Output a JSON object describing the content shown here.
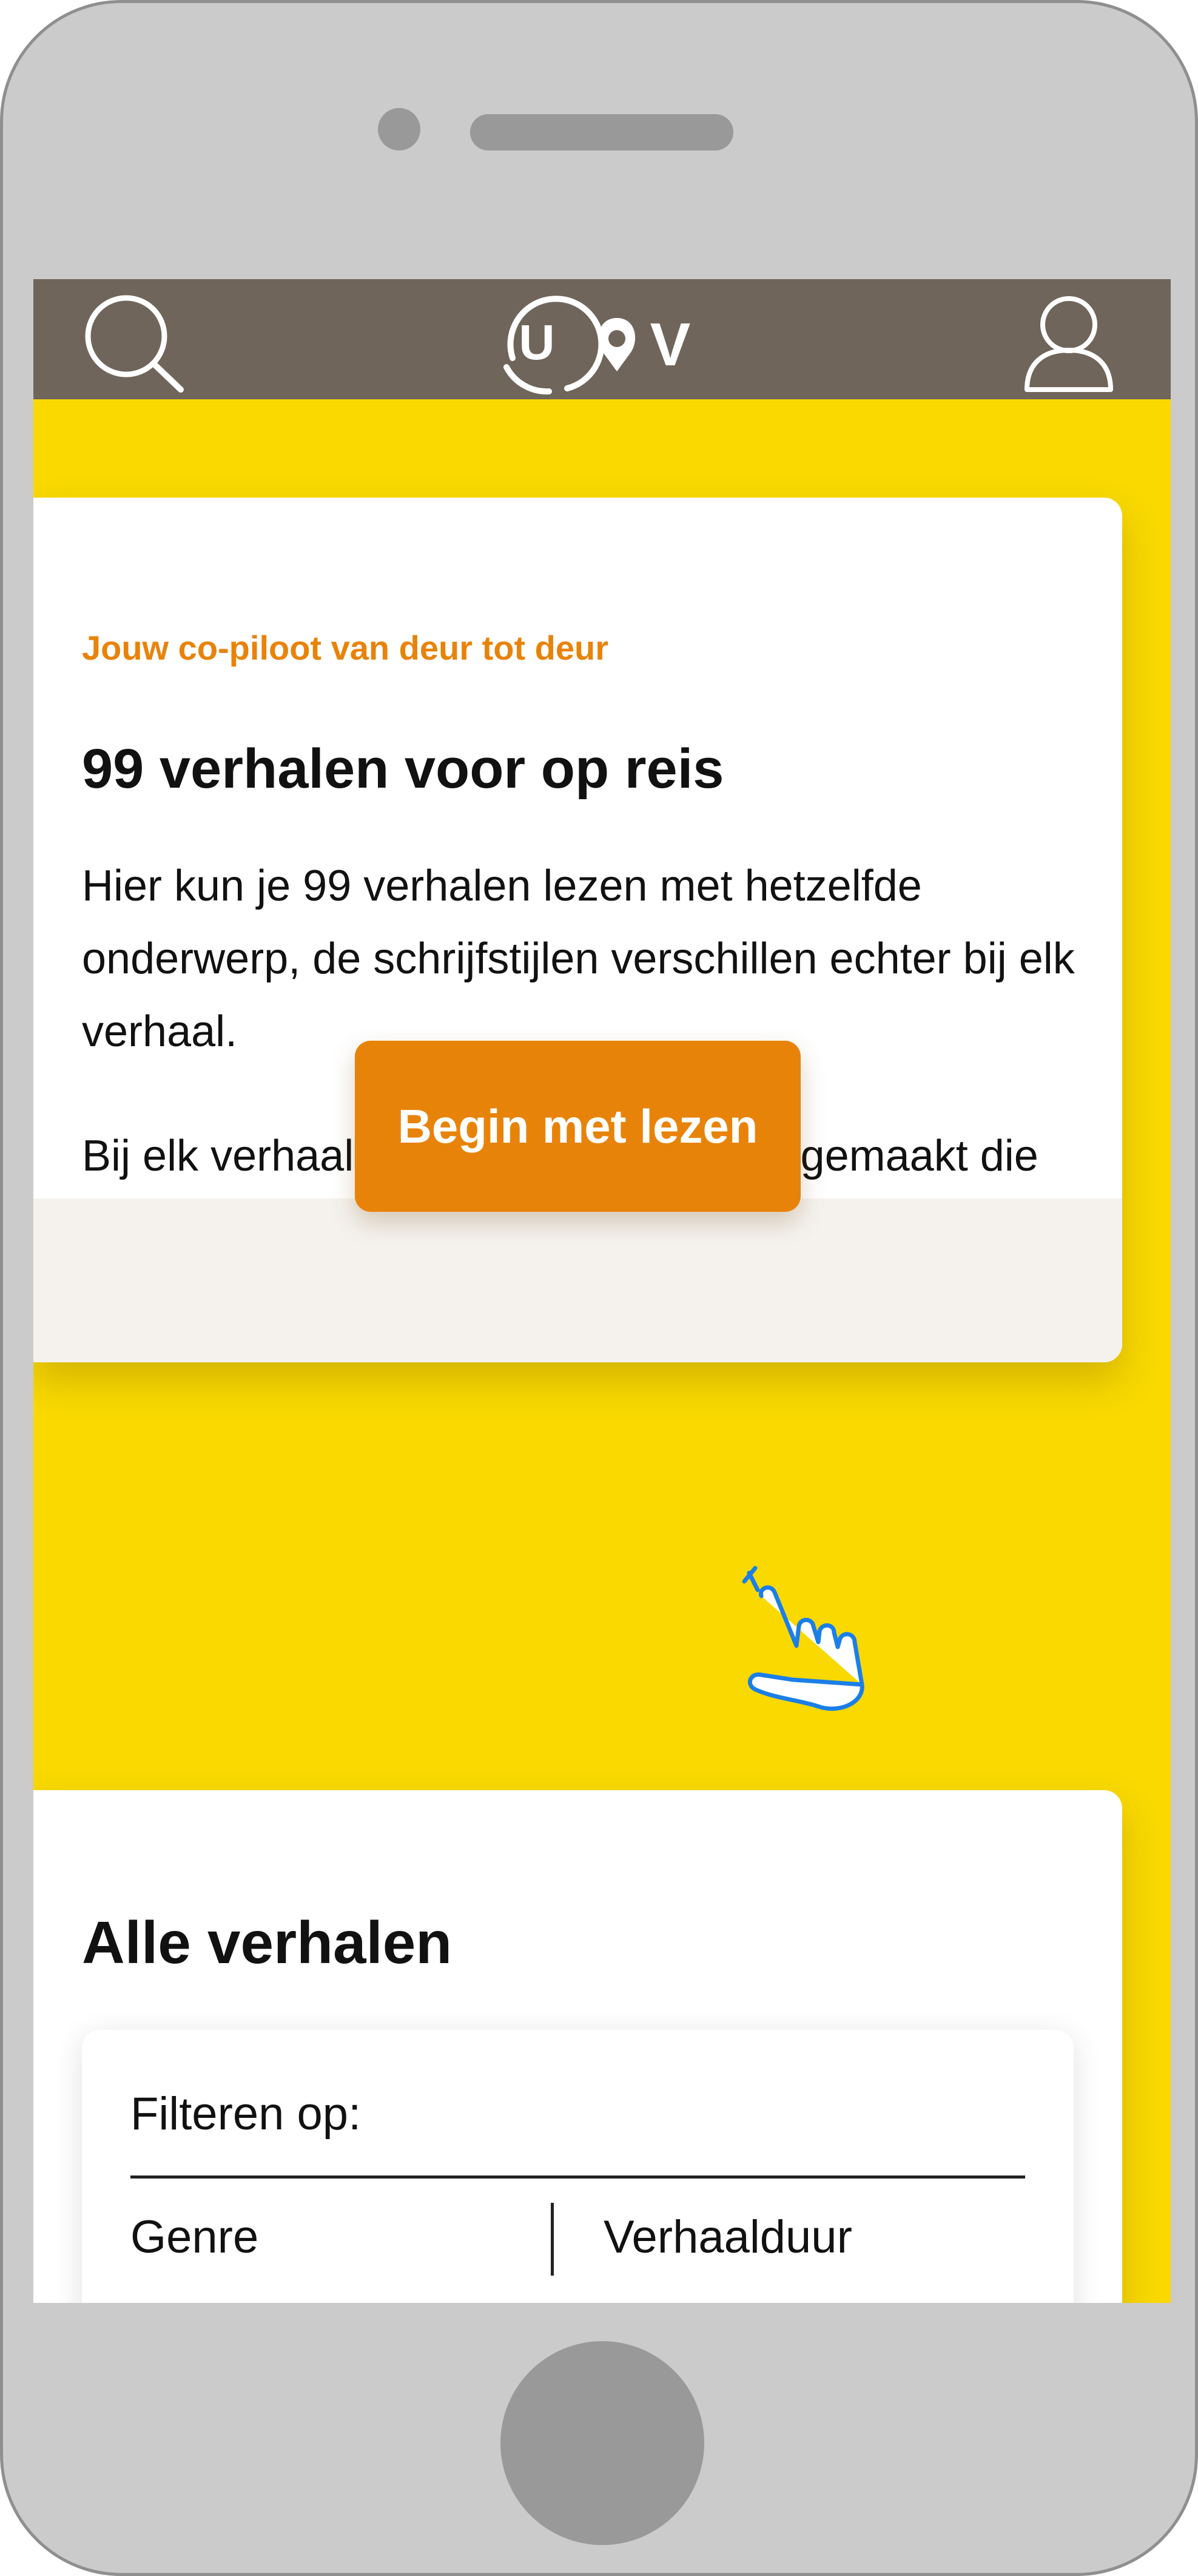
{
  "header": {
    "logo_text": "UOV",
    "search_icon": "search-icon",
    "account_icon": "user-icon"
  },
  "intro_card": {
    "tagline": "Jouw co-piloot van deur tot deur",
    "title": "99 verhalen voor op reis",
    "paragraph_1": "Hier kun je 99 verhalen lezen met hetzelfde onderwerp, de schrijfstijlen verschillen echter bij elk verhaal.",
    "paragraph_2": "Bij elk verhaal zijn kleine schilderijen gemaakt die het verhaal ondersteunen en interessanter maken.",
    "cta_label": "Begin met lezen"
  },
  "stories_card": {
    "title": "Alle verhalen",
    "filter": {
      "label": "Filteren op:",
      "options": [
        "Genre",
        "Verhaalduur"
      ]
    }
  },
  "colors": {
    "page_background": "#f9d900",
    "header_background": "#6f655b",
    "accent": "#e8830a",
    "device_frame": "#cbcbcb",
    "card_footer": "#f5f2ee",
    "pointer_hand": "#1a7fe8"
  }
}
